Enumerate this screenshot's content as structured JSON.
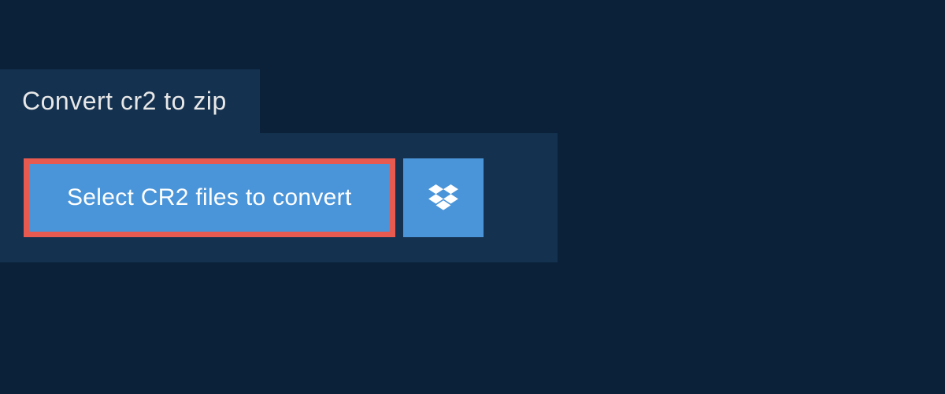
{
  "tab": {
    "title": "Convert cr2 to zip"
  },
  "actions": {
    "select_files_label": "Select CR2 files to convert",
    "dropbox_icon": "dropbox"
  },
  "colors": {
    "background": "#0a2139",
    "panel": "#14314f",
    "button": "#4a95d9",
    "highlight_border": "#e85a4f",
    "text_light": "#ffffff",
    "text_tab": "#e8e8e8"
  }
}
